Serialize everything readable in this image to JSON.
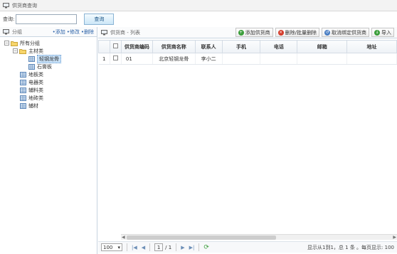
{
  "window": {
    "title": "供货商查询"
  },
  "search": {
    "label": "查询:",
    "value": "",
    "placeholder": "",
    "button": "查询"
  },
  "left_panel": {
    "title": "分组",
    "links": {
      "add": "•添加",
      "edit": "•修改",
      "delete": "•删除"
    },
    "tree": {
      "root": "所有分组",
      "group": "主材类",
      "children": [
        "轻钢龙骨",
        "石膏板"
      ],
      "others": [
        "地板类",
        "电器类",
        "辅料类",
        "地砖类",
        "辅材"
      ]
    }
  },
  "right_panel": {
    "title": "供货商 - 列表",
    "buttons": {
      "add": "添加供货商",
      "delete": "删除/批量删除",
      "unbind": "取消绑定供货商",
      "import": "导入"
    },
    "columns": [
      "",
      "供货商编码",
      "供货商名称",
      "联系人",
      "手机",
      "电话",
      "邮箱",
      "地址"
    ],
    "rows": [
      {
        "index": "1",
        "code": "01",
        "name": "北京轻钢龙骨",
        "contact": "李小二",
        "mobile": "",
        "phone": "",
        "email": "",
        "address": ""
      }
    ]
  },
  "pager": {
    "page_size": "100",
    "current_page": "1",
    "total_pages": "/ 1",
    "info": "显示从1到1，总 1 条 。每页显示: 100"
  }
}
